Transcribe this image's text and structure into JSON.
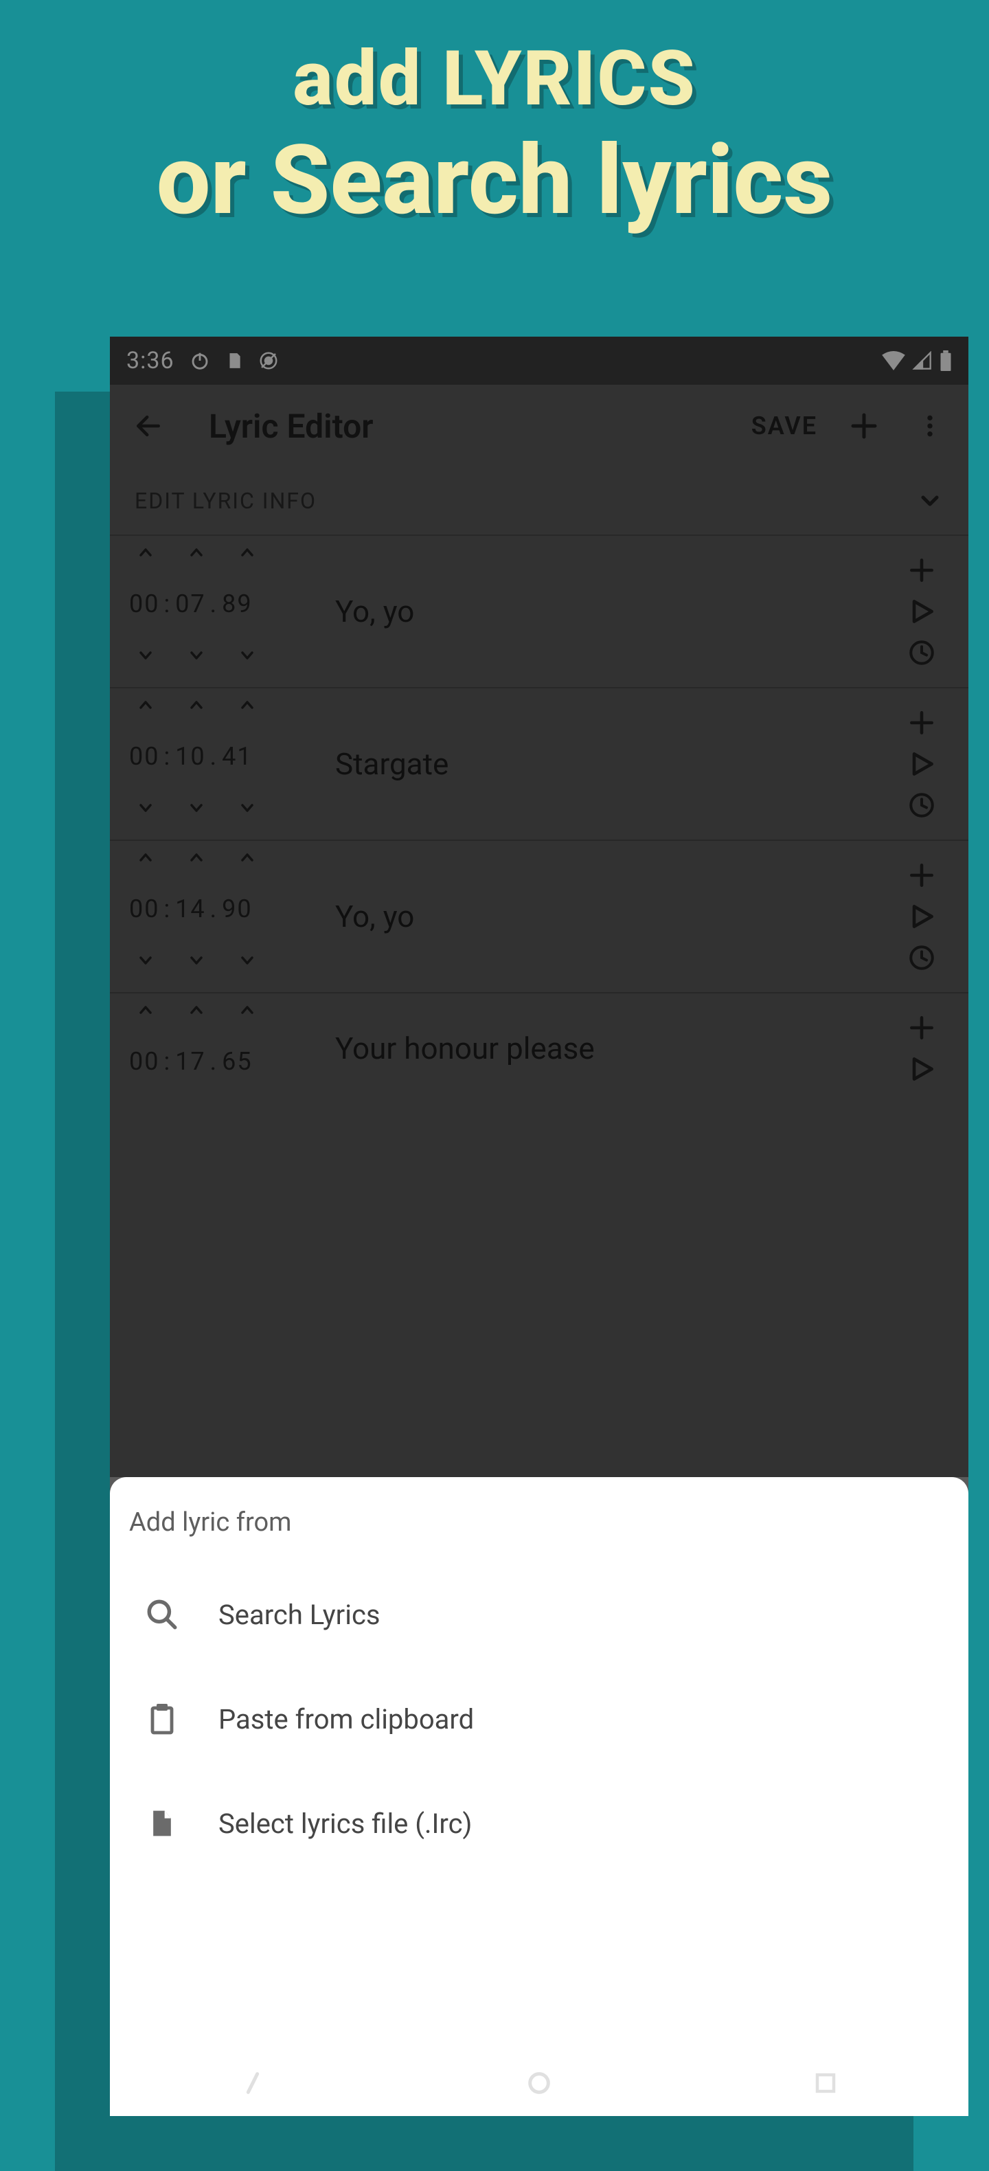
{
  "headline": {
    "line1": "add LYRICS",
    "line2": "or Search lyrics"
  },
  "status": {
    "clock": "3:36"
  },
  "appbar": {
    "title": "Lyric Editor",
    "save": "SAVE"
  },
  "info_row": {
    "label": "EDIT LYRIC INFO"
  },
  "lines": [
    {
      "mm": "00",
      "ss": "07",
      "cs": "89",
      "text": "Yo, yo"
    },
    {
      "mm": "00",
      "ss": "10",
      "cs": "41",
      "text": "Stargate"
    },
    {
      "mm": "00",
      "ss": "14",
      "cs": "90",
      "text": "Yo, yo"
    },
    {
      "mm": "00",
      "ss": "17",
      "cs": "65",
      "text": "Your honour please"
    }
  ],
  "sheet": {
    "title": "Add lyric from",
    "items": [
      {
        "icon": "search",
        "label": "Search Lyrics"
      },
      {
        "icon": "clipboard",
        "label": "Paste from clipboard"
      },
      {
        "icon": "file",
        "label": "Select lyrics file (.Irc)"
      }
    ]
  },
  "timecode_sep1": ":",
  "timecode_sep2": "."
}
